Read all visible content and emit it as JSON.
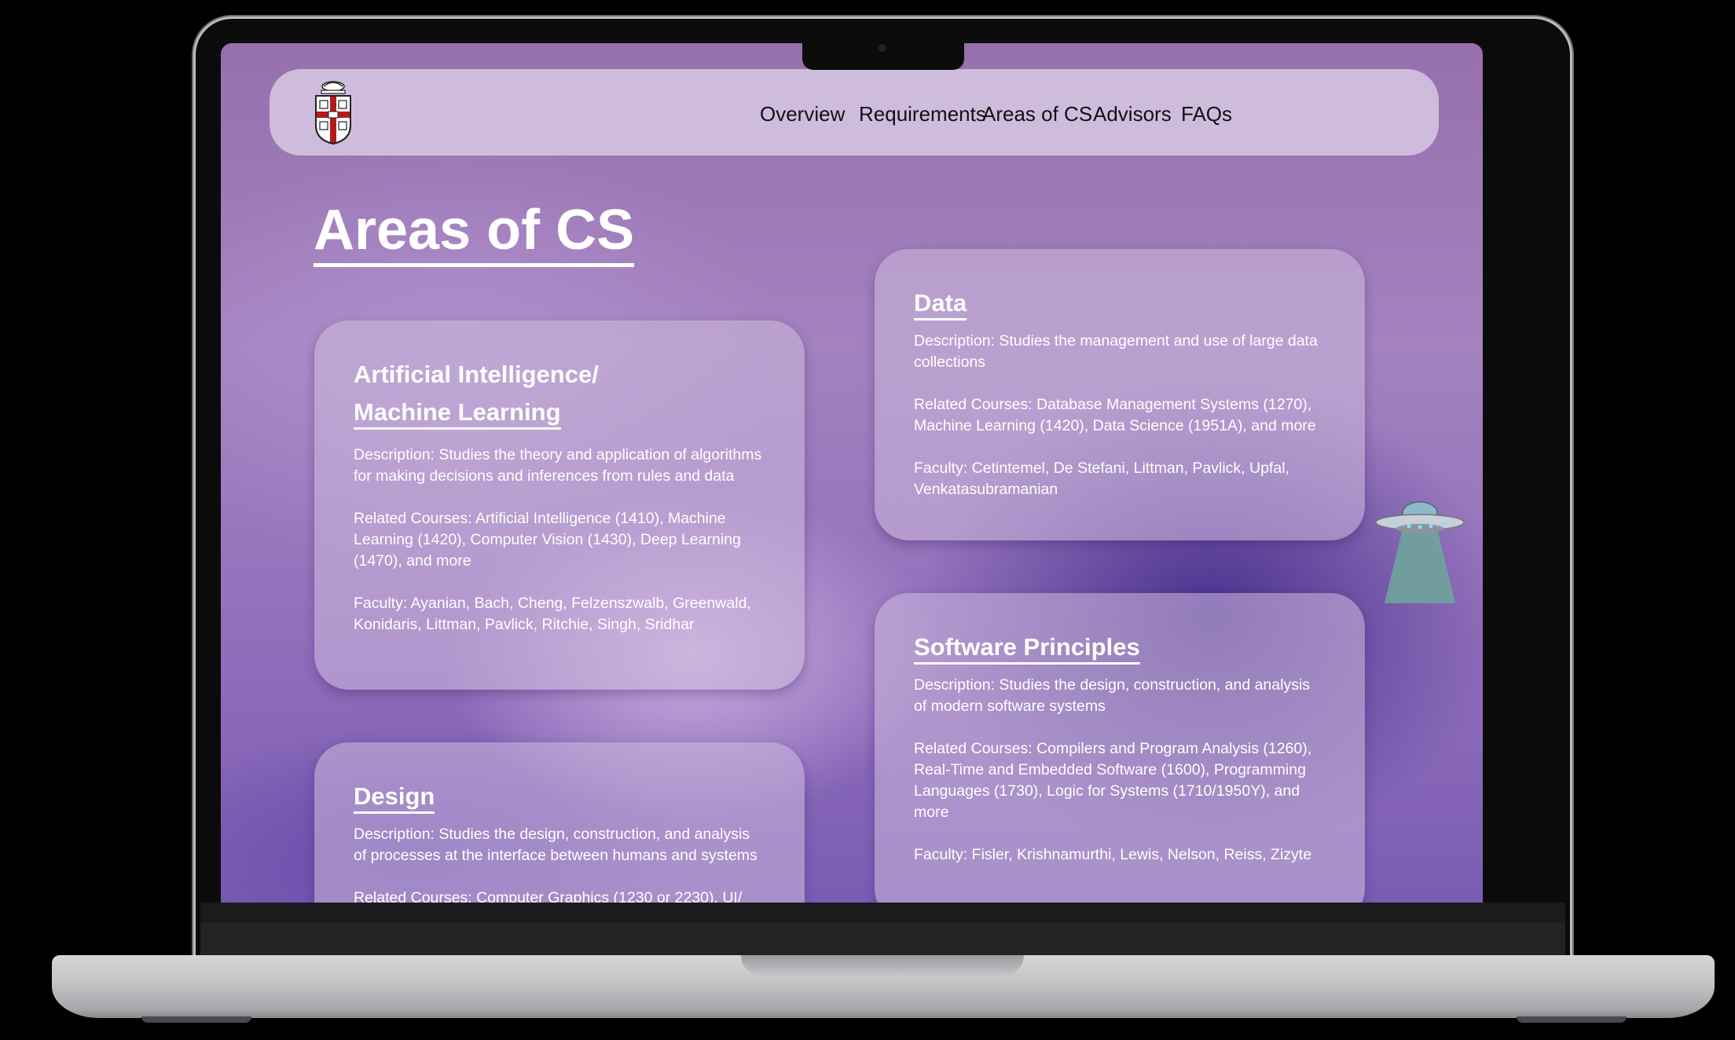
{
  "nav": {
    "logo_icon": "brown-university-shield-icon",
    "items": [
      "Overview",
      "Requirements",
      "Areas of CS",
      "Advisors",
      "FAQs"
    ]
  },
  "page": {
    "title": "Areas of CS"
  },
  "cards": {
    "ai": {
      "title_line1": "Artificial Intelligence/",
      "title_line2": "Machine Learning",
      "description": "Description: Studies the theory and application of algorithms for making decisions and inferences from rules and data",
      "courses": "Related Courses: Artificial Intelligence (1410), Machine Learning (1420), Computer Vision (1430), Deep Learning (1470), and more",
      "faculty": "Faculty: Ayanian, Bach, Cheng, Felzenszwalb, Greenwald, Konidaris, Littman, Pavlick, Ritchie, Singh, Sridhar"
    },
    "data": {
      "title": "Data",
      "description": "Description: Studies the management and use of large data collections",
      "courses": "Related Courses: Database Management Systems (1270), Machine Learning (1420), Data Science (1951A), and more",
      "faculty": "Faculty: Cetintemel, De Stefani, Littman, Pavlick, Upfal, Venkatasubramanian"
    },
    "software": {
      "title": "Software Principles",
      "description": "Description: Studies the design, construction, and analysis of modern software systems",
      "courses": "Related Courses: Compilers and Program Analysis (1260), Real-Time and Embedded Software (1600), Programming Languages (1730), Logic for Systems (1710/1950Y), and more",
      "faculty": "Faculty: Fisler, Krishnamurthi, Lewis, Nelson, Reiss, Zizyte"
    },
    "design": {
      "title": "Design",
      "description": "Description: Studies the design, construction, and analysis of processes at the interface between humans and systems",
      "courses": "Related Courses: Computer Graphics (1230 or 2230), UI/"
    }
  },
  "decor": {
    "ufo_icon": "ufo-icon"
  },
  "colors": {
    "accent": "#9670ad",
    "nav_bg": "#d6c6e2",
    "text": "#ffffff"
  }
}
